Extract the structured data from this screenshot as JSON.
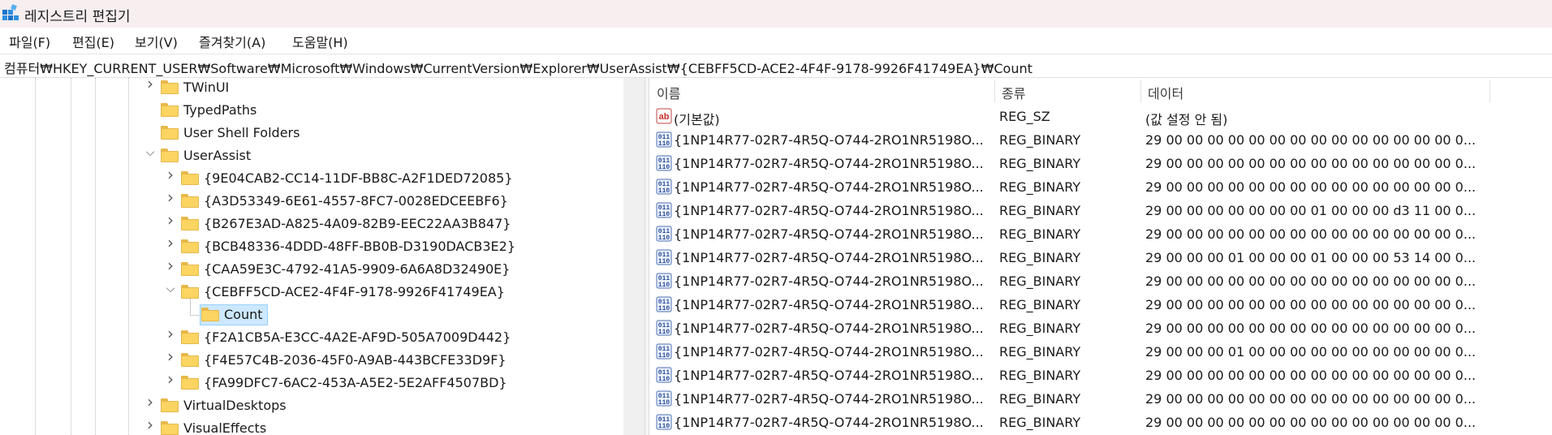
{
  "window": {
    "title": "레지스트리 편집기"
  },
  "menu": [
    "파일(F)",
    "편집(E)",
    "보기(V)",
    "즐겨찾기(A)",
    "도움말(H)"
  ],
  "address": "컴퓨터₩HKEY_CURRENT_USER₩Software₩Microsoft₩Windows₩CurrentVersion₩Explorer₩UserAssist₩{CEBFF5CD-ACE2-4F4F-9178-9926F41749EA}₩Count",
  "tree": [
    {
      "label": "TWinUI",
      "state": "collapsed"
    },
    {
      "label": "TypedPaths",
      "state": "leaf"
    },
    {
      "label": "User Shell Folders",
      "state": "leaf"
    },
    {
      "label": "UserAssist",
      "state": "expanded"
    },
    {
      "label": "{9E04CAB2-CC14-11DF-BB8C-A2F1DED72085}",
      "state": "collapsed"
    },
    {
      "label": "{A3D53349-6E61-4557-8FC7-0028EDCEEBF6}",
      "state": "collapsed"
    },
    {
      "label": "{B267E3AD-A825-4A09-82B9-EEC22AA3B847}",
      "state": "collapsed"
    },
    {
      "label": "{BCB48336-4DDD-48FF-BB0B-D3190DACB3E2}",
      "state": "collapsed"
    },
    {
      "label": "{CAA59E3C-4792-41A5-9909-6A6A8D32490E}",
      "state": "collapsed"
    },
    {
      "label": "{CEBFF5CD-ACE2-4F4F-9178-9926F41749EA}",
      "state": "expanded"
    },
    {
      "label": "Count",
      "state": "leaf",
      "selected": true
    },
    {
      "label": "{F2A1CB5A-E3CC-4A2E-AF9D-505A7009D442}",
      "state": "collapsed"
    },
    {
      "label": "{F4E57C4B-2036-45F0-A9AB-443BCFE33D9F}",
      "state": "collapsed"
    },
    {
      "label": "{FA99DFC7-6AC2-453A-A5E2-5E2AFF4507BD}",
      "state": "collapsed"
    },
    {
      "label": "VirtualDesktops",
      "state": "collapsed"
    },
    {
      "label": "VisualEffects",
      "state": "collapsed"
    }
  ],
  "columns": {
    "name": "이름",
    "type": "종류",
    "data": "데이터"
  },
  "values": [
    {
      "icon": "string-value-icon",
      "name": "(기본값)",
      "type": "REG_SZ",
      "data": "(값 설정 안 됨)"
    },
    {
      "icon": "binary-value-icon",
      "name": "{1NP14R77-02R7-4R5Q-O744-2RO1NR5198O...",
      "type": "REG_BINARY",
      "data": "29 00 00 00 00 00 00 00 00 00 00 00 00 00 00 0..."
    },
    {
      "icon": "binary-value-icon",
      "name": "{1NP14R77-02R7-4R5Q-O744-2RO1NR5198O...",
      "type": "REG_BINARY",
      "data": "29 00 00 00 00 00 00 00 00 00 00 00 00 00 00 0..."
    },
    {
      "icon": "binary-value-icon",
      "name": "{1NP14R77-02R7-4R5Q-O744-2RO1NR5198O...",
      "type": "REG_BINARY",
      "data": "29 00 00 00 00 00 00 00 00 00 00 00 00 00 00 0..."
    },
    {
      "icon": "binary-value-icon",
      "name": "{1NP14R77-02R7-4R5Q-O744-2RO1NR5198O...",
      "type": "REG_BINARY",
      "data": "29 00 00 00 00 00 00 00 01 00 00 00 d3 11 00 0..."
    },
    {
      "icon": "binary-value-icon",
      "name": "{1NP14R77-02R7-4R5Q-O744-2RO1NR5198O...",
      "type": "REG_BINARY",
      "data": "29 00 00 00 00 00 00 00 00 00 00 00 00 00 00 0..."
    },
    {
      "icon": "binary-value-icon",
      "name": "{1NP14R77-02R7-4R5Q-O744-2RO1NR5198O...",
      "type": "REG_BINARY",
      "data": "29 00 00 00 01 00 00 00 01 00 00 00 53 14 00 0..."
    },
    {
      "icon": "binary-value-icon",
      "name": "{1NP14R77-02R7-4R5Q-O744-2RO1NR5198O...",
      "type": "REG_BINARY",
      "data": "29 00 00 00 00 00 00 00 00 00 00 00 00 00 00 0..."
    },
    {
      "icon": "binary-value-icon",
      "name": "{1NP14R77-02R7-4R5Q-O744-2RO1NR5198O...",
      "type": "REG_BINARY",
      "data": "29 00 00 00 00 00 00 00 00 00 00 00 00 00 00 0..."
    },
    {
      "icon": "binary-value-icon",
      "name": "{1NP14R77-02R7-4R5Q-O744-2RO1NR5198O...",
      "type": "REG_BINARY",
      "data": "29 00 00 00 00 00 00 00 00 00 00 00 00 00 00 0..."
    },
    {
      "icon": "binary-value-icon",
      "name": "{1NP14R77-02R7-4R5Q-O744-2RO1NR5198O...",
      "type": "REG_BINARY",
      "data": "29 00 00 00 01 00 00 00 00 00 00 00 00 00 00 0..."
    },
    {
      "icon": "binary-value-icon",
      "name": "{1NP14R77-02R7-4R5Q-O744-2RO1NR5198O...",
      "type": "REG_BINARY",
      "data": "29 00 00 00 00 00 00 00 00 00 00 00 00 00 00 0..."
    },
    {
      "icon": "binary-value-icon",
      "name": "{1NP14R77-02R7-4R5Q-O744-2RO1NR5198O...",
      "type": "REG_BINARY",
      "data": "29 00 00 00 00 00 00 00 00 00 00 00 00 00 00 0..."
    },
    {
      "icon": "binary-value-icon",
      "name": "{1NP14R77-02R7-4R5Q-O744-2RO1NR5198O...",
      "type": "REG_BINARY",
      "data": "29 00 00 00 00 00 00 00 00 00 00 00 00 00 00 0..."
    }
  ]
}
